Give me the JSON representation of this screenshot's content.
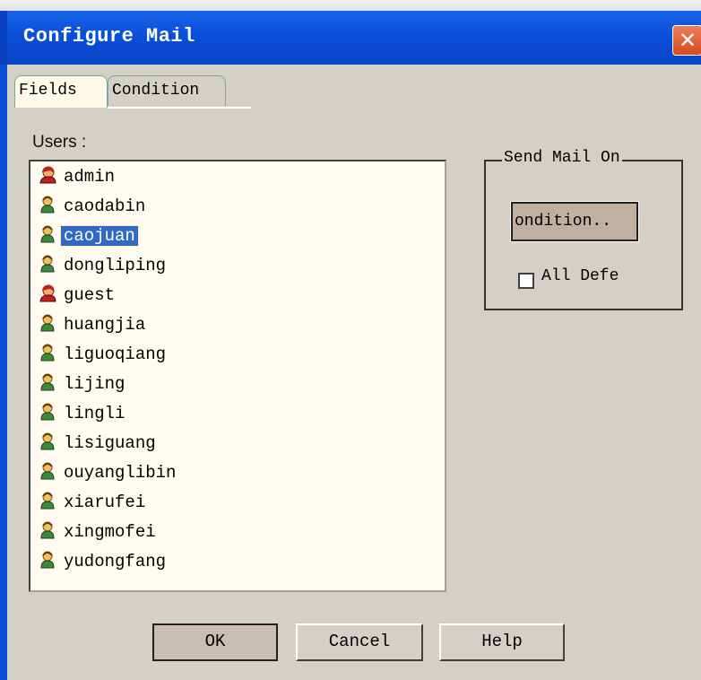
{
  "window": {
    "title": "Configure Mail",
    "close_glyph": "✕"
  },
  "tabs": [
    {
      "label": "Fields",
      "active": true
    },
    {
      "label": "Condition",
      "active": false
    }
  ],
  "users_panel": {
    "label": "Users :",
    "items": [
      {
        "name": "admin",
        "icon": "admin-user-icon",
        "selected": false
      },
      {
        "name": "caodabin",
        "icon": "user-icon",
        "selected": false
      },
      {
        "name": "caojuan",
        "icon": "user-icon",
        "selected": true
      },
      {
        "name": "dongliping",
        "icon": "user-icon",
        "selected": false
      },
      {
        "name": "guest",
        "icon": "admin-user-icon",
        "selected": false
      },
      {
        "name": "huangjia",
        "icon": "user-icon",
        "selected": false
      },
      {
        "name": "liguoqiang",
        "icon": "user-icon",
        "selected": false
      },
      {
        "name": "lijing",
        "icon": "user-icon",
        "selected": false
      },
      {
        "name": "lingli",
        "icon": "user-icon",
        "selected": false
      },
      {
        "name": "lisiguang",
        "icon": "user-icon",
        "selected": false
      },
      {
        "name": "ouyanglibin",
        "icon": "user-icon",
        "selected": false
      },
      {
        "name": "xiarufei",
        "icon": "user-icon",
        "selected": false
      },
      {
        "name": "xingmofei",
        "icon": "user-icon",
        "selected": false
      },
      {
        "name": "yudongfang",
        "icon": "user-icon",
        "selected": false
      }
    ],
    "scroll_up": "▲",
    "scroll_down": "▼"
  },
  "send_mail_group": {
    "title": "Send Mail On",
    "condition_button": "ondition..",
    "all_default_label": "All Defe",
    "all_default_checked": false
  },
  "buttons": {
    "ok": "OK",
    "cancel": "Cancel",
    "help": "Help"
  },
  "colors": {
    "titlebar": "#0a4fd9",
    "selection": "#316ac5",
    "dialog_bg": "#d4d0c8"
  }
}
